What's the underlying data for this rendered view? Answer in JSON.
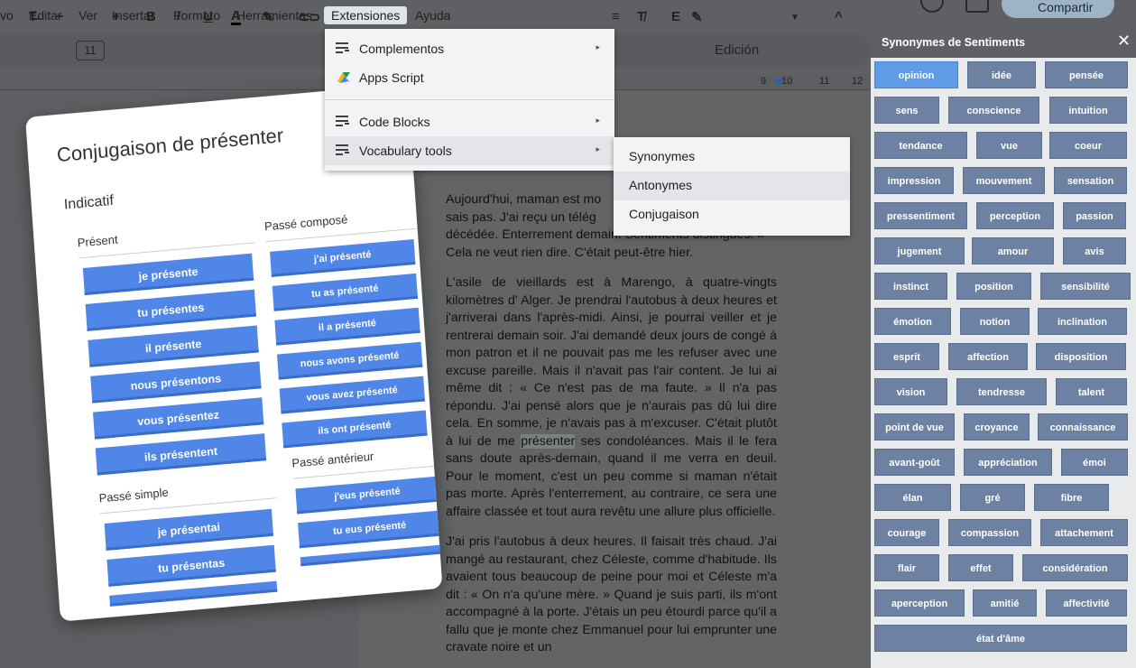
{
  "menubar": {
    "items": [
      "vo",
      "Editar",
      "Ver",
      "Insertar",
      "Formato",
      "Herramientas",
      "Extensiones",
      "Ayuda"
    ],
    "share_label": "Compartir"
  },
  "toolbar": {
    "font_size": "11",
    "mode_label": "Edición"
  },
  "ruler": {
    "numbers": [
      "9",
      "10",
      "11",
      "12"
    ]
  },
  "extensions_menu": {
    "items": [
      {
        "label": "Complementos",
        "icon": "list-add-icon",
        "has_submenu": true
      },
      {
        "label": "Apps Script",
        "icon": "apps-script-icon",
        "has_submenu": false
      },
      {
        "label": "Code Blocks",
        "icon": "list-add-icon",
        "has_submenu": true
      },
      {
        "label": "Vocabulary tools",
        "icon": "list-add-icon",
        "has_submenu": true
      }
    ],
    "submenu_arrow": "▸"
  },
  "vocabulary_submenu": {
    "items": [
      "Synonymes",
      "Antonymes",
      "Conjugaison"
    ]
  },
  "conjugation": {
    "title": "Conjugaison de présenter",
    "mood": "Indicatif",
    "tenses": [
      {
        "name": "Présent",
        "forms": [
          "je présente",
          "tu présentes",
          "il présente",
          "nous présentons",
          "vous présentez",
          "ils présentent"
        ]
      },
      {
        "name": "Passé composé",
        "forms": [
          "j'ai présenté",
          "tu as présenté",
          "il a présenté",
          "nous avons présenté",
          "vous avez présenté",
          "ils ont présenté"
        ]
      },
      {
        "name": "Passé simple",
        "forms": [
          "je présentai",
          "tu présentas"
        ]
      },
      {
        "name": "Passé antérieur",
        "forms": [
          "j'eus présenté",
          "tu eus présenté"
        ]
      }
    ]
  },
  "document": {
    "p1_lines": [
      "Aujourd'hui, maman est mo",
      "sais pas. J'ai reçu un télég",
      "décédée. Enterrement demain. Sentiments distingués. »",
      "Cela ne veut rien dire. C'était peut-être hier."
    ],
    "p2_before": "L'asile de vieillards est à Marengo, à quatre-vingts kilomètres d' Alger. Je prendrai l'autobus à deux heures et j'arriverai dans l'après-midi. Ainsi, je pourrai veiller et je rentrerai demain soir. J'ai demandé deux jours de congé à mon patron et il ne pouvait pas me les refuser avec une excuse pareille. Mais il n'avait pas l'air content. Je lui ai même dit : « Ce n'est pas de ma faute. » Il n'a pas répondu. J'ai pensé alors que je n'aurais pas dû lui dire cela. En somme, je n'avais pas à m'excuser. C'était plutôt à lui de me ",
    "p2_highlight": "présenter",
    "p2_after": " ses condoléances. Mais il le fera sans doute après-demain, quand il me verra en deuil. Pour le moment, c'est un peu comme si maman n'était pas morte. Après l'enterrement, au contraire, ce sera une affaire classée et tout aura revêtu une allure plus officielle.",
    "p3": "J'ai pris l'autobus à deux heures. Il faisait très chaud. J'ai mangé au restaurant, chez Céleste, comme d'habitude. Ils avaient tous beaucoup de peine pour moi et Céleste m'a dit : « On n'a qu'une mère. » Quand je suis parti, ils m'ont accompagné à la porte. J'étais un peu étourdi parce qu'il a fallu que je monte chez Emmanuel pour lui emprunter une cravate noire et un"
  },
  "sidebar": {
    "title": "Synonymes de Sentiments",
    "rows": [
      [
        "opinion",
        "idée",
        "pensée"
      ],
      [
        "sens",
        "conscience",
        "intuition"
      ],
      [
        "tendance",
        "vue",
        "coeur"
      ],
      [
        "impression",
        "mouvement",
        "sensation"
      ],
      [
        "pressentiment",
        "perception",
        "passion"
      ],
      [
        "jugement",
        "amour",
        "avis"
      ],
      [
        "instinct",
        "position",
        "sensibilité"
      ],
      [
        "émotion",
        "notion",
        "inclination"
      ],
      [
        "esprit",
        "affection",
        "disposition"
      ],
      [
        "vision",
        "tendresse",
        "talent"
      ],
      [
        "point de vue",
        "croyance",
        "connaissance"
      ],
      [
        "avant-goût",
        "appréciation",
        "émoi"
      ],
      [
        "élan",
        "gré",
        "fibre"
      ],
      [
        "courage",
        "compassion",
        "attachement"
      ],
      [
        "flair",
        "effet",
        "considération"
      ],
      [
        "aperception",
        "amitié",
        "affectivité"
      ],
      [
        "état d'âme"
      ]
    ],
    "colors": {
      "button": "#6d82a3",
      "active": "#5f9be6"
    }
  }
}
